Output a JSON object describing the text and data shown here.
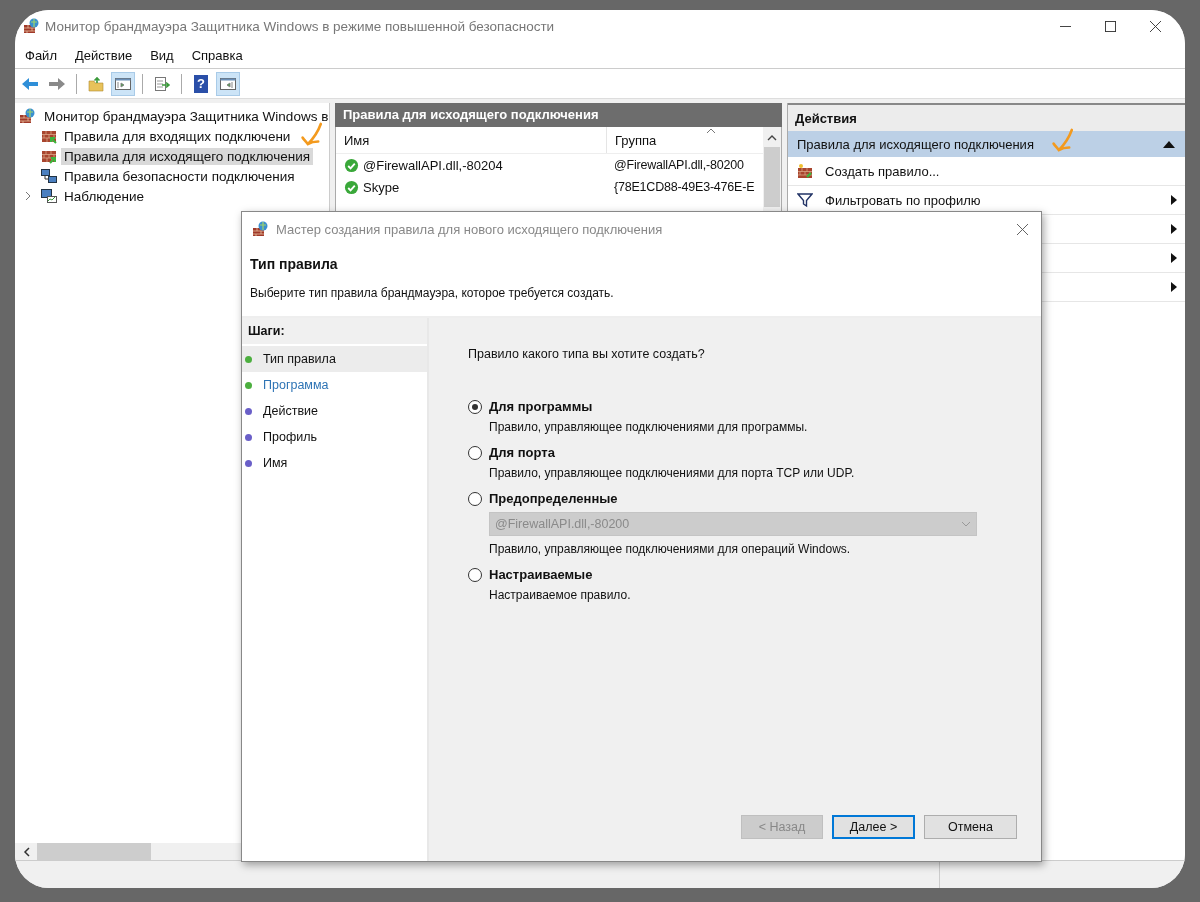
{
  "window": {
    "title": "Монитор брандмауэра Защитника Windows в режиме повышенной безопасности"
  },
  "menu": [
    "Файл",
    "Действие",
    "Вид",
    "Справка"
  ],
  "toolbar_groups": [
    [
      {
        "kind": "back",
        "pressed": false
      },
      {
        "kind": "forward",
        "pressed": false
      }
    ],
    [
      {
        "kind": "folder-up",
        "pressed": false
      },
      {
        "kind": "tree-pane",
        "pressed": true
      }
    ],
    [
      {
        "kind": "export",
        "pressed": false
      }
    ],
    [
      {
        "kind": "help",
        "glyph": "?",
        "pressed": false
      },
      {
        "kind": "action-pane",
        "pressed": true
      }
    ]
  ],
  "tree": {
    "label": "Монитор брандмауэра Защитника Windows в",
    "selected": false,
    "children": [
      {
        "label": "Правила для входящих подключени",
        "kind": "inbound",
        "selected": false
      },
      {
        "label": "Правила для исходящего подключения",
        "kind": "outbound",
        "selected": true
      },
      {
        "label": "Правила безопасности подключения",
        "kind": "security",
        "selected": false
      },
      {
        "label": "Наблюдение",
        "kind": "monitoring",
        "selected": false,
        "expanded": false
      }
    ]
  },
  "rules_panel": {
    "title": "Правила для исходящего подключения",
    "columns": [
      "Имя",
      "Группа"
    ],
    "rows": [
      {
        "name": "@FirewallAPI.dll,-80204",
        "group": "@FirewallAPI.dll,-80200",
        "enabled": true
      },
      {
        "name": "Skype",
        "group": "{78E1CD88-49E3-476E-E",
        "enabled": true
      }
    ]
  },
  "actions": {
    "title": "Действия",
    "section": {
      "label": "Правила для исходящего подключения",
      "expanded": true
    },
    "items": [
      {
        "kind": "new-rule",
        "label": "Создать правило...",
        "submenu": false
      },
      {
        "kind": "filter",
        "label": "Фильтровать по профилю",
        "submenu": true
      },
      {
        "submenu": true
      },
      {
        "submenu": true
      },
      {
        "submenu": true
      }
    ]
  },
  "dialog": {
    "title": "Мастер создания правила для нового исходящего подключения",
    "heading": "Тип правила",
    "subtitle": "Выберите тип правила брандмауэра, которое требуется создать.",
    "steps_title": "Шаги:",
    "steps": [
      {
        "label": "Тип правила",
        "color": "#4caf3f",
        "selected": true,
        "link": false
      },
      {
        "label": "Программа",
        "color": "#4caf3f",
        "selected": false,
        "link": true
      },
      {
        "label": "Действие",
        "color": "#6a5fc8",
        "selected": false,
        "link": false
      },
      {
        "label": "Профиль",
        "color": "#6a5fc8",
        "selected": false,
        "link": false
      },
      {
        "label": "Имя",
        "color": "#6a5fc8",
        "selected": false,
        "link": false
      }
    ],
    "question": "Правило какого типа вы хотите создать?",
    "options": [
      {
        "label": "Для программы",
        "description": "Правило, управляющее подключениями для программы.",
        "selected": true
      },
      {
        "label": "Для порта",
        "description": "Правило, управляющее подключениями для порта TCP или UDP.",
        "selected": false
      },
      {
        "label": "Предопределенные",
        "dropdown": {
          "value": "@FirewallAPI.dll,-80200",
          "disabled": true
        },
        "description": "Правило, управляющее подключениями для операций Windows.",
        "selected": false
      },
      {
        "label": "Настраиваемые",
        "description": "Настраиваемое правило.",
        "selected": false
      }
    ],
    "buttons": [
      {
        "label": "< Назад",
        "disabled": true,
        "default": false
      },
      {
        "label": "Далее >",
        "disabled": false,
        "default": true
      },
      {
        "label": "Отмена",
        "disabled": false,
        "default": false
      }
    ]
  }
}
